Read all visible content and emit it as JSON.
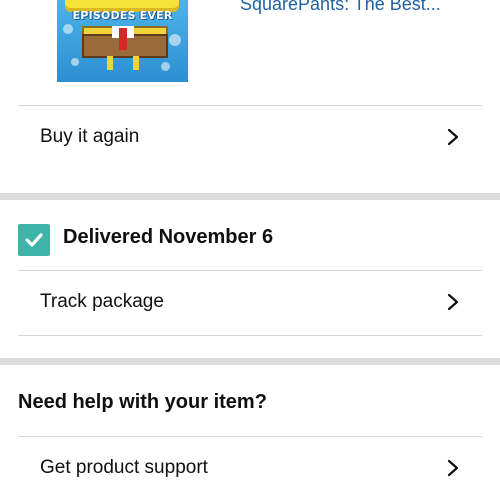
{
  "product": {
    "image_text": "EPISODES EVER",
    "title": "SquarePants: The Best..."
  },
  "actions": {
    "buy_again": "Buy it again",
    "track_package": "Track package",
    "product_support": "Get product support"
  },
  "delivery": {
    "status": "Delivered November 6",
    "status_color": "#3cb4a8"
  },
  "help": {
    "heading": "Need help with your item?"
  },
  "icons": {
    "chevron": "chevron-right-icon",
    "check": "checkmark-icon"
  },
  "colors": {
    "link": "#2162a1",
    "separator_band": "#dcdcdc",
    "row_border": "#d5d9d9"
  }
}
